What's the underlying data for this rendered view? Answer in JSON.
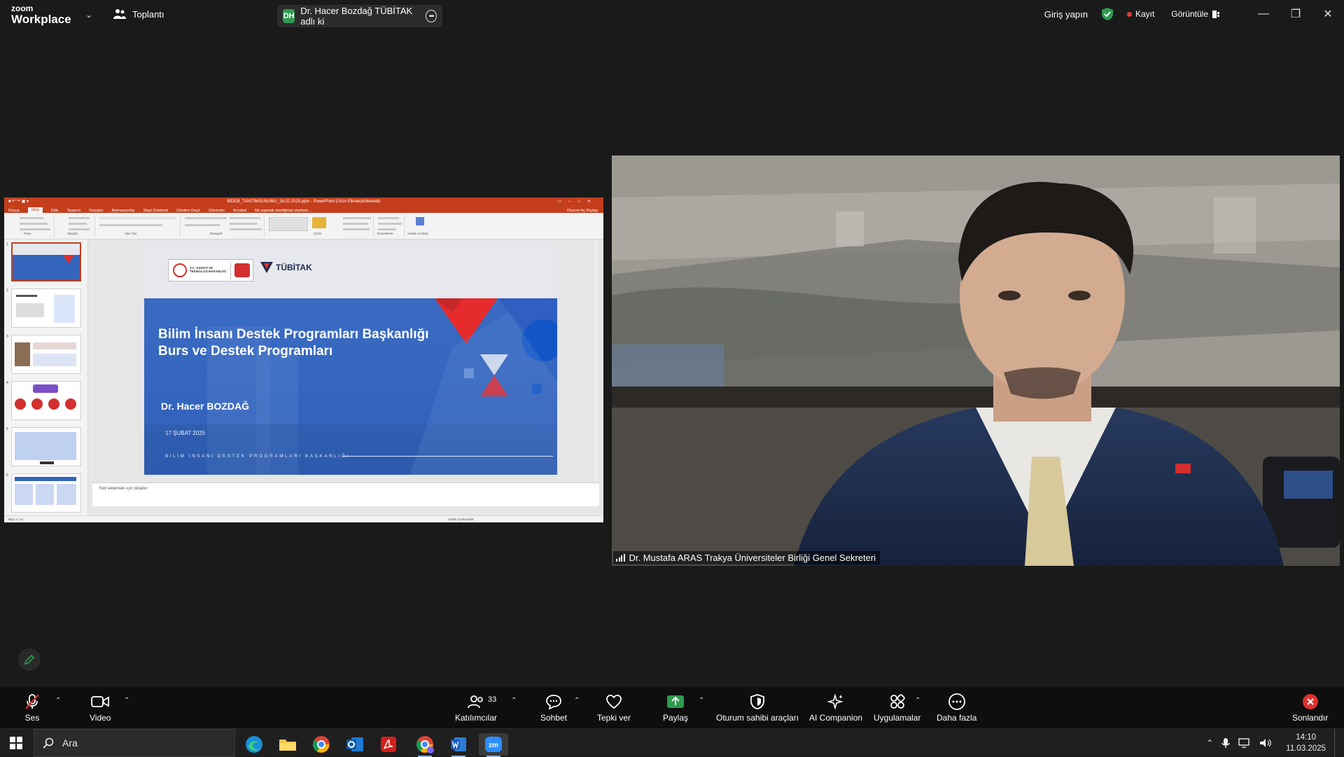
{
  "app": {
    "brand_line1": "zoom",
    "brand_line2": "Workplace",
    "meeting_label": "Toplantı"
  },
  "speaker_pill": {
    "initials": "DH",
    "text": "Dr. Hacer Bozdağ TÜBİTAK adlı ki"
  },
  "top_right": {
    "signin": "Giriş yapın",
    "record": "Kayıt",
    "view": "Görüntüle"
  },
  "colors": {
    "accent_green": "#2e9a4f",
    "record_red": "#e23b3b",
    "ppt_red": "#c43e1c",
    "slide_blue": "#3465bd",
    "end_red": "#e02f2f"
  },
  "powerpoint": {
    "title": "BİDEB_TANITIMSUNUMU_16.02.2025.pptx - PowerPoint (Ürün Etkinleştirilemedi)",
    "tabs": [
      "Dosya",
      "Giriş",
      "Ekle",
      "Tasarım",
      "Geçişler",
      "Animasyonlar",
      "Slayt Gösterisi",
      "Gözden Geçir",
      "Görünüm",
      "Acrobat",
      "Ne yapmak istediğinizi söyleyin..."
    ],
    "tabs_right": "Oturum Aç  Paylaş",
    "ribbon_groups": [
      "Pano",
      "Slaytlar",
      "Yazı Tipi",
      "Paragraf",
      "Çizim",
      "Düzenleme",
      "Adobe Acrobat"
    ],
    "thumb_numbers": [
      "1",
      "2",
      "3",
      "4",
      "5",
      "6"
    ],
    "notes_placeholder": "Not eklemek için tıklatın",
    "status_left": "Slayt 1 / 31",
    "status_right": "Notlar   Açıklamalar"
  },
  "slide": {
    "logo_text_1": "T.C. SANAYİ VE",
    "logo_text_2": "TEKNOLOJİ BAKANLIĞI",
    "brand_right": "TÜBİTAK",
    "title_line1": "Bilim İnsanı Destek Programları Başkanlığı",
    "title_line2": "Burs ve Destek Programları",
    "presenter": "Dr. Hacer BOZDAĞ",
    "date": "17 ŞUBAT 2025",
    "footer": "BİLİM İNSANI DESTEK PROGRAMLARI BAŞKANLIĞI"
  },
  "video": {
    "name": "Dr. Mustafa ARAS Trakya Üniversiteler Birliği Genel Sekreteri"
  },
  "toolbar": {
    "audio": "Ses",
    "video": "Video",
    "participants": "Katılımcılar",
    "participants_count": "33",
    "chat": "Sohbet",
    "react": "Tepki ver",
    "share": "Paylaş",
    "host_tools": "Oturum sahibi araçları",
    "ai_companion": "AI Companion",
    "apps": "Uygulamalar",
    "more": "Daha fazla",
    "end": "Sonlandır"
  },
  "taskbar": {
    "search_placeholder": "Ara",
    "time": "14:10",
    "date": "11.03.2025",
    "apps": [
      "edge-icon",
      "file-explorer-icon",
      "chrome-icon",
      "outlook-icon",
      "acrobat-icon",
      "chrome-profile-icon",
      "word-icon",
      "zoom-icon"
    ]
  }
}
